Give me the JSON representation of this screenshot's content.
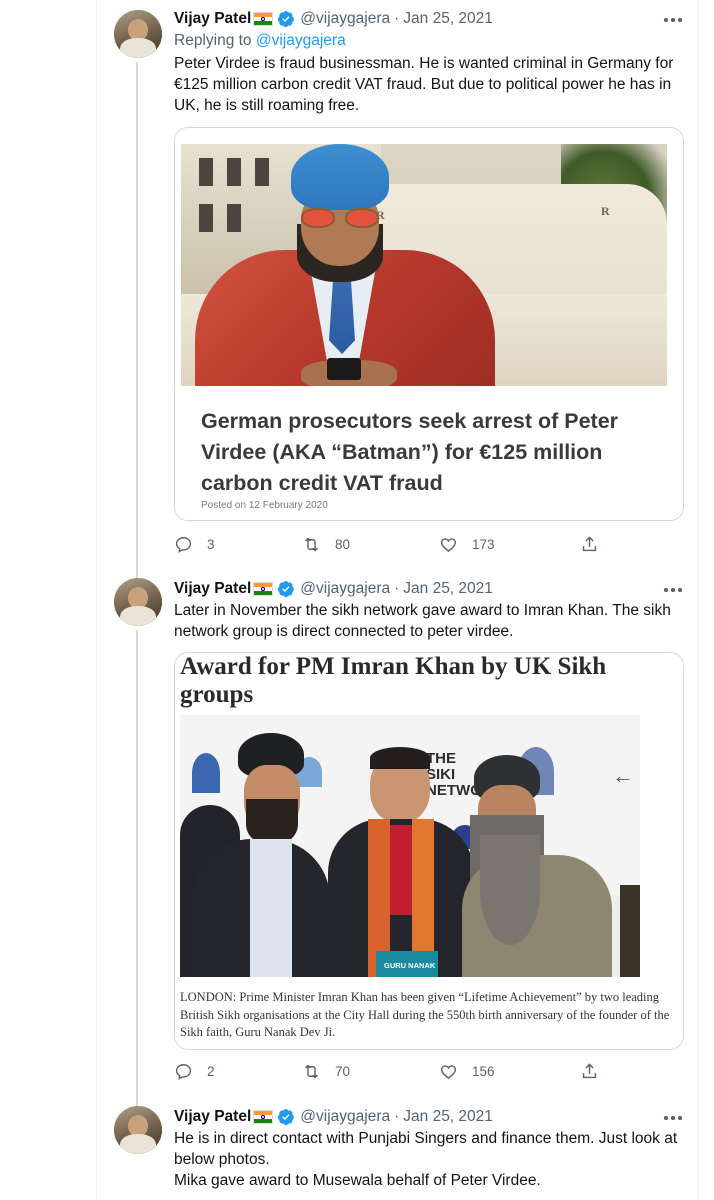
{
  "colors": {
    "link": "#1d9bf0",
    "muted": "#536471",
    "text": "#0f1419",
    "border": "#cfd9de"
  },
  "tweets": [
    {
      "name": "Vijay Patel",
      "handle": "@vijaygajera",
      "separator": "·",
      "date": "Jan 25, 2021",
      "replying_prefix": "Replying to",
      "replying_to": "@vijaygajera",
      "lines": [
        "Peter Virdee is fraud businessman. He is wanted criminal in Germany for",
        "€125 million carbon credit VAT fraud. But due to political power he has in",
        "UK, he is still roaming free."
      ],
      "card": {
        "title": "German prosecutors seek arrest of Peter Virdee (AKA “Batman”) for €125 million carbon credit VAT fraud",
        "posted": "Posted on 12 February 2020",
        "logo_mark": "R"
      },
      "counts": {
        "replies": "3",
        "retweets": "80",
        "likes": "173"
      }
    },
    {
      "name": "Vijay Patel",
      "handle": "@vijaygajera",
      "separator": "·",
      "date": "Jan 25, 2021",
      "lines": [
        "Later in November the sikh network gave award to Imran Khan. The sikh",
        "network group is direct connected to peter virdee."
      ],
      "card": {
        "headline": "Award for PM Imran Khan by UK Sikh groups",
        "banner_text": "THE SIKH NETWORK",
        "banner_short": "THE SIKI NETWO",
        "plaque": "GURU NANAK",
        "caption": "LONDON: Prime Minister Imran Khan has been given “Lifetime Achievement” by two leading British Sikh organisations at the City Hall during the 550th birth anniversary of the founder of the Sikh faith, Guru Nanak Dev Ji."
      },
      "counts": {
        "replies": "2",
        "retweets": "70",
        "likes": "156"
      }
    },
    {
      "name": "Vijay Patel",
      "handle": "@vijaygajera",
      "separator": "·",
      "date": "Jan 25, 2021",
      "lines": [
        "He is in direct contact with Punjabi Singers and finance them. Just look at",
        "below photos.",
        "Mika gave award to Musewala behalf of Peter Virdee."
      ]
    }
  ]
}
